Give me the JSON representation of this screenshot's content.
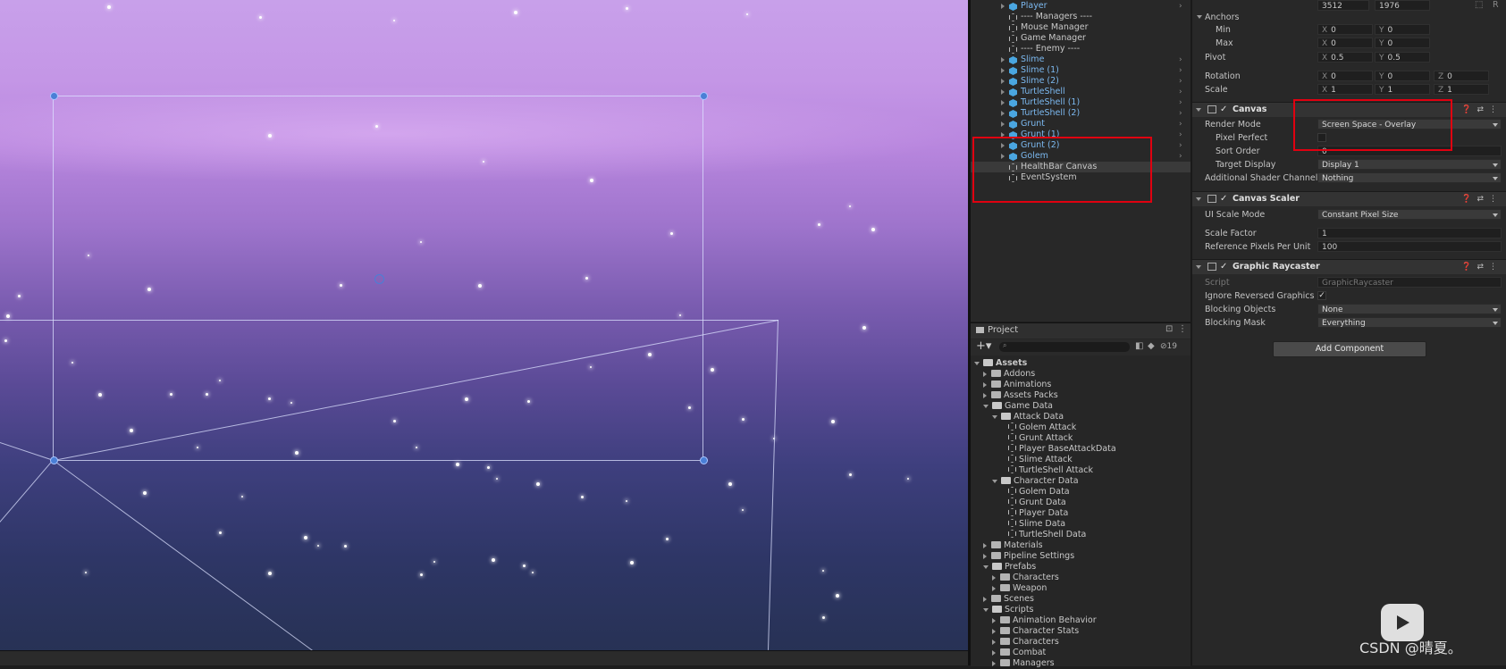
{
  "hierarchy": {
    "items": [
      {
        "label": "Player",
        "prefab": true,
        "arrow": true,
        "chev": true
      },
      {
        "label": "---- Managers ----",
        "prefab": false,
        "arrow": false,
        "chev": false
      },
      {
        "label": "Mouse Manager",
        "prefab": false,
        "arrow": false,
        "chev": false
      },
      {
        "label": "Game Manager",
        "prefab": false,
        "arrow": false,
        "chev": false
      },
      {
        "label": "---- Enemy ----",
        "prefab": false,
        "arrow": false,
        "chev": false
      },
      {
        "label": "Slime",
        "prefab": true,
        "arrow": true,
        "chev": true
      },
      {
        "label": "Slime (1)",
        "prefab": true,
        "arrow": true,
        "chev": true
      },
      {
        "label": "Slime (2)",
        "prefab": true,
        "arrow": true,
        "chev": true
      },
      {
        "label": "TurtleShell",
        "prefab": true,
        "arrow": true,
        "chev": true
      },
      {
        "label": "TurtleShell (1)",
        "prefab": true,
        "arrow": true,
        "chev": true
      },
      {
        "label": "TurtleShell (2)",
        "prefab": true,
        "arrow": true,
        "chev": true
      },
      {
        "label": "Grunt",
        "prefab": true,
        "arrow": true,
        "chev": true
      },
      {
        "label": "Grunt (1)",
        "prefab": true,
        "arrow": true,
        "chev": true
      },
      {
        "label": "Grunt (2)",
        "prefab": true,
        "arrow": true,
        "chev": true
      },
      {
        "label": "Golem",
        "prefab": true,
        "arrow": true,
        "chev": true
      },
      {
        "label": "HealthBar Canvas",
        "prefab": false,
        "arrow": false,
        "chev": false,
        "selected": true
      },
      {
        "label": "EventSystem",
        "prefab": false,
        "arrow": false,
        "chev": false
      }
    ]
  },
  "project": {
    "tab": "Project",
    "hidden_count": "19",
    "tree": [
      {
        "label": "Assets",
        "depth": 0,
        "open": true,
        "type": "folder",
        "bold": true
      },
      {
        "label": "Addons",
        "depth": 1,
        "open": false,
        "type": "folder"
      },
      {
        "label": "Animations",
        "depth": 1,
        "open": false,
        "type": "folder"
      },
      {
        "label": "Assets Packs",
        "depth": 1,
        "open": false,
        "type": "folder"
      },
      {
        "label": "Game Data",
        "depth": 1,
        "open": true,
        "type": "folder"
      },
      {
        "label": "Attack Data",
        "depth": 2,
        "open": true,
        "type": "folder"
      },
      {
        "label": "Golem Attack",
        "depth": 3,
        "type": "asset"
      },
      {
        "label": "Grunt Attack",
        "depth": 3,
        "type": "asset"
      },
      {
        "label": "Player BaseAttackData",
        "depth": 3,
        "type": "asset"
      },
      {
        "label": "Slime Attack",
        "depth": 3,
        "type": "asset"
      },
      {
        "label": "TurtleShell Attack",
        "depth": 3,
        "type": "asset"
      },
      {
        "label": "Character Data",
        "depth": 2,
        "open": true,
        "type": "folder"
      },
      {
        "label": "Golem Data",
        "depth": 3,
        "type": "asset"
      },
      {
        "label": "Grunt Data",
        "depth": 3,
        "type": "asset"
      },
      {
        "label": "Player Data",
        "depth": 3,
        "type": "asset"
      },
      {
        "label": "Slime Data",
        "depth": 3,
        "type": "asset"
      },
      {
        "label": "TurtleShell Data",
        "depth": 3,
        "type": "asset"
      },
      {
        "label": "Materials",
        "depth": 1,
        "open": false,
        "type": "folder"
      },
      {
        "label": "Pipeline Settings",
        "depth": 1,
        "open": false,
        "type": "folder"
      },
      {
        "label": "Prefabs",
        "depth": 1,
        "open": true,
        "type": "folder"
      },
      {
        "label": "Characters",
        "depth": 2,
        "open": false,
        "type": "folder"
      },
      {
        "label": "Weapon",
        "depth": 2,
        "open": false,
        "type": "folder"
      },
      {
        "label": "Scenes",
        "depth": 1,
        "open": false,
        "type": "folder"
      },
      {
        "label": "Scripts",
        "depth": 1,
        "open": true,
        "type": "folder"
      },
      {
        "label": "Animation Behavior",
        "depth": 2,
        "open": false,
        "type": "folder"
      },
      {
        "label": "Character Stats",
        "depth": 2,
        "open": false,
        "type": "folder"
      },
      {
        "label": "Characters",
        "depth": 2,
        "open": false,
        "type": "folder"
      },
      {
        "label": "Combat",
        "depth": 2,
        "open": false,
        "type": "folder"
      },
      {
        "label": "Managers",
        "depth": 2,
        "open": false,
        "type": "folder"
      }
    ]
  },
  "inspector": {
    "top": {
      "w": "3512",
      "h": "1976",
      "r_label": "R"
    },
    "anchors_label": "Anchors",
    "min_label": "Min",
    "min_x": "0",
    "min_y": "0",
    "max_label": "Max",
    "max_x": "0",
    "max_y": "0",
    "pivot_label": "Pivot",
    "pivot_x": "0.5",
    "pivot_y": "0.5",
    "rotation_label": "Rotation",
    "rot_x": "0",
    "rot_y": "0",
    "rot_z": "0",
    "scale_label": "Scale",
    "scale_x": "1",
    "scale_y": "1",
    "scale_z": "1",
    "axis_x": "X",
    "axis_y": "Y",
    "axis_z": "Z",
    "canvas": {
      "title": "Canvas",
      "render_mode_label": "Render Mode",
      "render_mode": "Screen Space - Overlay",
      "pixel_perfect_label": "Pixel Perfect",
      "sort_order_label": "Sort Order",
      "sort_order": "0",
      "target_display_label": "Target Display",
      "target_display": "Display 1",
      "shader_channels_label": "Additional Shader Channels",
      "shader_channels": "Nothing"
    },
    "scaler": {
      "title": "Canvas Scaler",
      "ui_scale_mode_label": "UI Scale Mode",
      "ui_scale_mode": "Constant Pixel Size",
      "scale_factor_label": "Scale Factor",
      "scale_factor": "1",
      "ref_ppu_label": "Reference Pixels Per Unit",
      "ref_ppu": "100"
    },
    "raycaster": {
      "title": "Graphic Raycaster",
      "script_label": "Script",
      "script": "GraphicRaycaster",
      "ignore_reversed_label": "Ignore Reversed Graphics",
      "ignore_reversed": "✓",
      "blocking_objects_label": "Blocking Objects",
      "blocking_objects": "None",
      "blocking_mask_label": "Blocking Mask",
      "blocking_mask": "Everything"
    },
    "add_component": "Add Component"
  },
  "watermark": "CSDN @晴夏。",
  "colors": {
    "highlight": "#e00010",
    "prefab": "#7cb9f0"
  }
}
